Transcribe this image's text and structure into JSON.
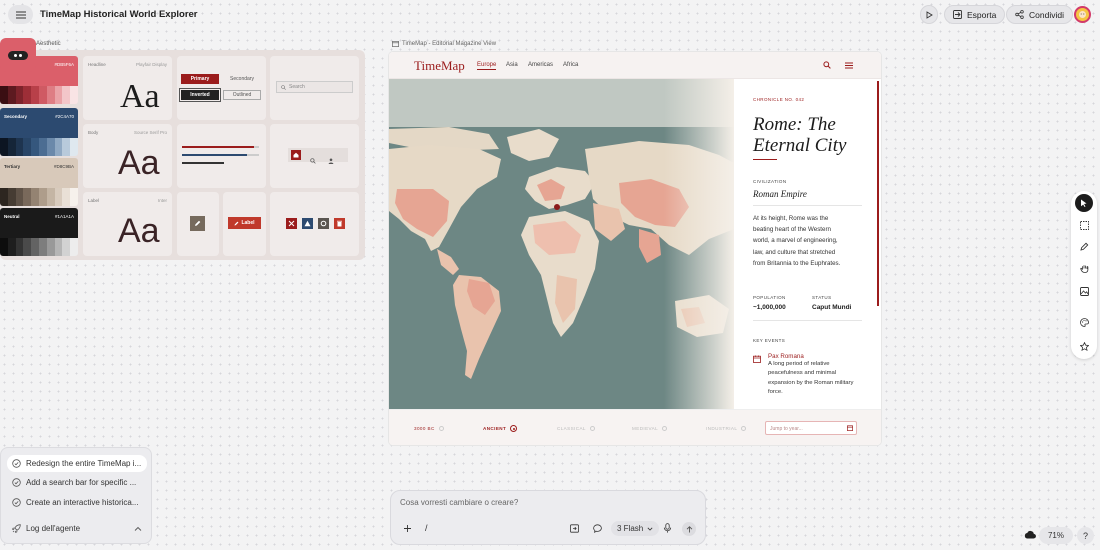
{
  "app": {
    "title": "TimeMap Historical World Explorer"
  },
  "toolbar": {
    "export_label": "Esporta",
    "share_label": "Condividi"
  },
  "design_system": {
    "label": "Aesthetic",
    "swatches": [
      {
        "name": "",
        "hex": "#DB5F6A",
        "color": "#db5f6a",
        "ramp": [
          "#3a0e12",
          "#5d1a20",
          "#7d232b",
          "#9d2e37",
          "#b84049",
          "#cf5a63",
          "#de7d84",
          "#eaa2a7",
          "#f3c6c9",
          "#f9e4e5"
        ]
      },
      {
        "name": "Secondary",
        "hex": "#2C4A70",
        "color": "#2c4a70",
        "ramp": [
          "#0c1522",
          "#152538",
          "#1e344f",
          "#284567",
          "#35577d",
          "#4c6d92",
          "#6b89aa",
          "#90a9c3",
          "#b8cadb",
          "#dfe8ef"
        ]
      },
      {
        "name": "Tertiary",
        "hex": "#D8C9BA",
        "color": "#d8c9ba",
        "ramp": [
          "#2d2620",
          "#463c33",
          "#5f5247",
          "#79695b",
          "#948372",
          "#ae9d8b",
          "#c4b5a4",
          "#d8cbbd",
          "#e9e0d6",
          "#f6f1ec"
        ]
      },
      {
        "name": "Neutral",
        "hex": "#1A1A1A",
        "color": "#1a1a1a",
        "ramp": [
          "#0d0d0d",
          "#1e1e1e",
          "#333333",
          "#4a4a4a",
          "#636363",
          "#7d7d7d",
          "#999999",
          "#b5b5b5",
          "#d2d2d2",
          "#ededed"
        ]
      }
    ],
    "typography": [
      {
        "role": "Headline",
        "font": "Playfair Display",
        "sample": "Aa"
      },
      {
        "role": "Body",
        "font": "Source Serif Pro",
        "sample": "Aa"
      },
      {
        "role": "Label",
        "font": "Inter",
        "sample": "Aa"
      }
    ],
    "buttons": {
      "primary": "Primary",
      "secondary": "Secondary",
      "inverted": "Inverted",
      "outlined": "Outlined"
    },
    "search_placeholder": "Search",
    "label_button": "Label"
  },
  "preview": {
    "label": "TimeMap - Editorial Magazine View",
    "logo": "TimeMap",
    "nav": [
      "Europe",
      "Asia",
      "Americas",
      "Africa"
    ],
    "chronicle": "CHRONICLE NO. 042",
    "title_line1": "Rome: The",
    "title_line2": "Eternal City",
    "civ_label": "CIVILIZATION",
    "civ_value": "Roman Empire",
    "description": [
      "At its height, Rome was the",
      "beating heart of the Western",
      "world, a marvel of engineering,",
      "law, and culture that stretched",
      "from Britannia to the Euphrates."
    ],
    "population_label": "POPULATION",
    "population_value": "~1,000,000",
    "status_label": "STATUS",
    "status_value": "Caput Mundi",
    "key_events_label": "KEY EVENTS",
    "event_title": "Pax Romana",
    "event_desc": [
      "A long period of relative",
      "peacefulness and minimal",
      "expansion by the Roman military",
      "force."
    ],
    "eras": [
      "3000 BC",
      "ANCIENT",
      "CLASSICAL",
      "MEDIEVAL",
      "INDUSTRIAL"
    ],
    "jump_placeholder": "Jump to year..."
  },
  "agent_log": {
    "items": [
      "Redesign the entire TimeMap i...",
      "Add a search bar for specific ...",
      "Create an interactive historica..."
    ],
    "title": "Log dell'agente"
  },
  "chat": {
    "placeholder": "Cosa vorresti cambiare o creare?",
    "slash": "/",
    "model": "3 Flash"
  },
  "zoom": "71%",
  "help": "?"
}
